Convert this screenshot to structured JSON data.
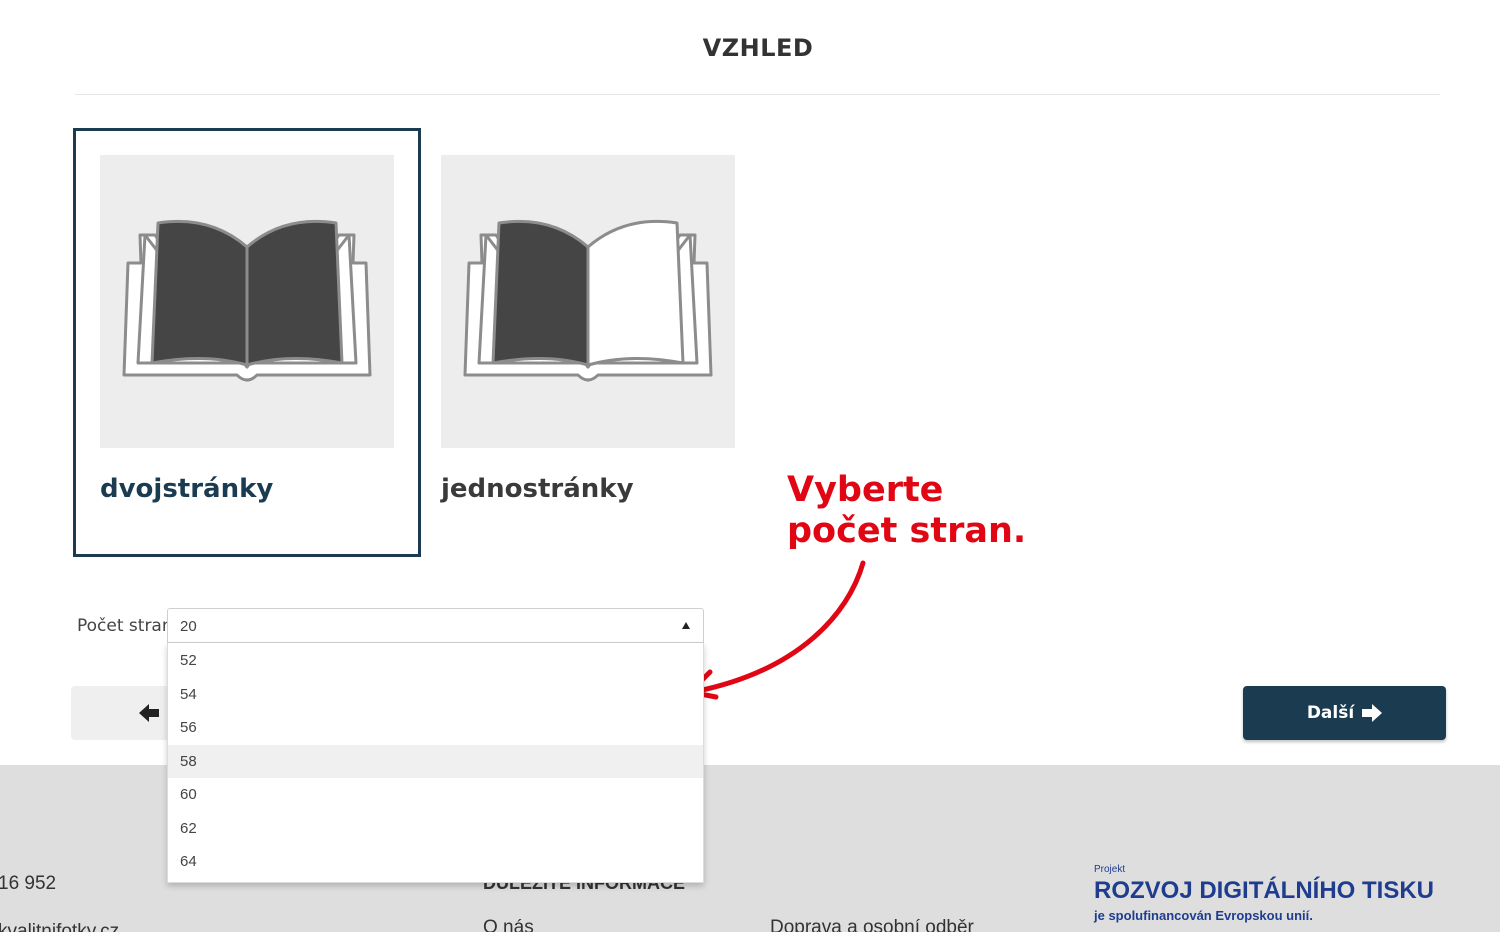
{
  "header": {
    "title": "VZHLED"
  },
  "layout_options": [
    {
      "label": "dvojstránky",
      "selected": true
    },
    {
      "label": "jednostránky",
      "selected": false
    }
  ],
  "annotation": {
    "line1": "Vyberte",
    "line2": "počet stran.",
    "color": "#e10613"
  },
  "page_count": {
    "label": "Počet stran",
    "value": "20",
    "options": [
      "52",
      "54",
      "56",
      "58",
      "60",
      "62",
      "64"
    ],
    "highlighted": "58"
  },
  "navigation": {
    "next_label": "Další"
  },
  "footer": {
    "phone": "16 952",
    "email": "kvalitnifotky.cz",
    "heading": "DŮLEŽITÉ INFORMACE",
    "link_about": "O nás",
    "link_shipping": "Doprava a osobní odběr",
    "eu_small": "Projekt",
    "eu_title": "ROZVOJ DIGITÁLNÍHO TISKU",
    "eu_subtitle": "je spolufinancován Evropskou unií."
  },
  "colors": {
    "primary": "#1b3b50",
    "annotation": "#e10613",
    "eu_blue": "#1f3d8f",
    "footer_bg": "#dedede"
  }
}
